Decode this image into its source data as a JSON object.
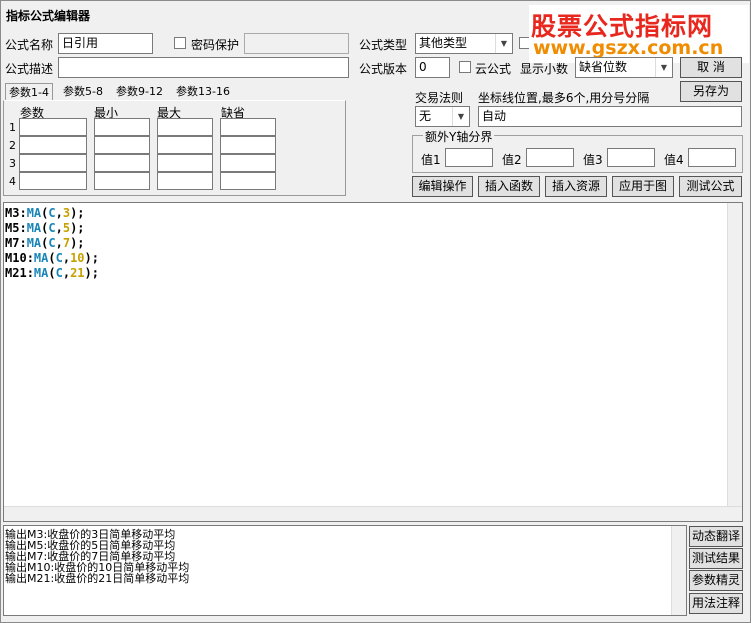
{
  "window": {
    "title": "指标公式编辑器"
  },
  "watermark": {
    "line1": "股票公式指标网",
    "line2": "www.gszx.com.cn"
  },
  "form": {
    "name_label": "公式名称",
    "name_value": "日引用",
    "password_label": "密码保护",
    "password_value": "",
    "type_label": "公式类型",
    "type_value": "其他类型",
    "desc_label": "公式描述",
    "desc_value": "",
    "version_label": "公式版本",
    "version_value": "0",
    "cloud_label": "云公式",
    "decimals_label": "显示小数",
    "decimals_value": "缺省位数",
    "trade_label": "交易法则",
    "trade_value": "无",
    "coord_label": "坐标线位置,最多6个,用分号分隔",
    "coord_value": "自动",
    "extra_axis_label": "额外Y轴分界",
    "extra_vals": [
      {
        "label": "值1",
        "value": ""
      },
      {
        "label": "值2",
        "value": ""
      },
      {
        "label": "值3",
        "value": ""
      },
      {
        "label": "值4",
        "value": ""
      }
    ]
  },
  "buttons": {
    "ok": "确 定",
    "cancel": "取 消",
    "save_as": "另存为",
    "edit_ops": "编辑操作",
    "insert_func": "插入函数",
    "insert_res": "插入资源",
    "apply": "应用于图",
    "test": "测试公式",
    "dyn_translate": "动态翻译",
    "test_result": "测试结果",
    "param_wizard": "参数精灵",
    "usage_note": "用法注释"
  },
  "params": {
    "tabs": [
      "参数1-4",
      "参数5-8",
      "参数9-12",
      "参数13-16"
    ],
    "headers": [
      "参数",
      "最小",
      "最大",
      "缺省"
    ],
    "rows": [
      "1",
      "2",
      "3",
      "4"
    ]
  },
  "code": [
    {
      "id": "M3",
      "fn": "MA",
      "arg": "C",
      "n": "3"
    },
    {
      "id": "M5",
      "fn": "MA",
      "arg": "C",
      "n": "5"
    },
    {
      "id": "M7",
      "fn": "MA",
      "arg": "C",
      "n": "7"
    },
    {
      "id": "M10",
      "fn": "MA",
      "arg": "C",
      "n": "10"
    },
    {
      "id": "M21",
      "fn": "MA",
      "arg": "C",
      "n": "21"
    }
  ],
  "output": [
    "输出M3:收盘价的3日简单移动平均",
    "输出M5:收盘价的5日简单移动平均",
    "输出M7:收盘价的7日简单移动平均",
    "输出M10:收盘价的10日简单移动平均",
    "输出M21:收盘价的21日简单移动平均"
  ]
}
